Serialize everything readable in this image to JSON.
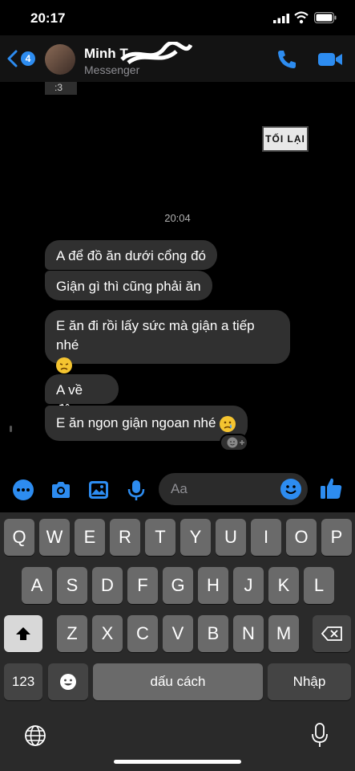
{
  "status": {
    "time": "20:17"
  },
  "header": {
    "back_badge": "4",
    "contact_name": "Minh T",
    "contact_sub": "Messenger"
  },
  "chat": {
    "peek_text": ":3",
    "sticker_text": "TỐI LẠI",
    "timestamp": "20:04",
    "messages": [
      {
        "text": "A để đồ ăn dưới cổng đó"
      },
      {
        "text": "Giận gì thì cũng phải ăn"
      },
      {
        "text": "E ăn đi rồi lấy sức mà giận a tiếp nhé"
      },
      {
        "text": "A về đây"
      },
      {
        "text": "E ăn ngon giận ngoan nhé"
      }
    ]
  },
  "composer": {
    "placeholder": "Aa"
  },
  "keyboard": {
    "row1": [
      "Q",
      "W",
      "E",
      "R",
      "T",
      "Y",
      "U",
      "I",
      "O",
      "P"
    ],
    "row2": [
      "A",
      "S",
      "D",
      "F",
      "G",
      "H",
      "J",
      "K",
      "L"
    ],
    "row3": [
      "Z",
      "X",
      "C",
      "V",
      "B",
      "N",
      "M"
    ],
    "numbers_label": "123",
    "space_label": "dấu cách",
    "return_label": "Nhập"
  },
  "colors": {
    "accent": "#2d8cf0",
    "bubble": "#303030",
    "keyboard_bg": "#2a2a2a"
  }
}
